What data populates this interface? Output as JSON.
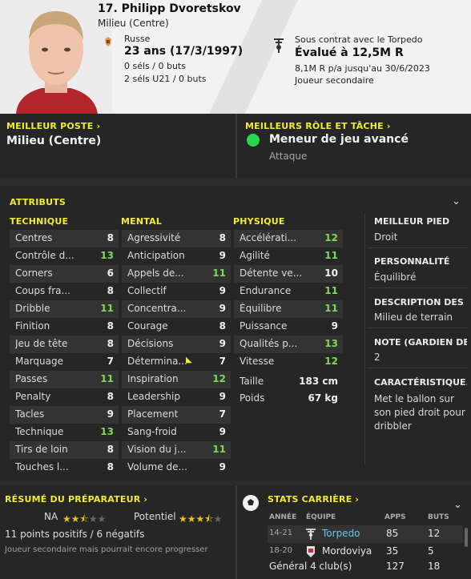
{
  "header": {
    "name": "17. Philipp Dvoretskov",
    "position": "Milieu (Centre)",
    "nationality": "Russe",
    "age": "23 ans (17/3/1997)",
    "selections": "0 séls / 0 buts",
    "u21": "2 séls U21 / 0 buts",
    "contract": "Sous contrat avec le Torpedo",
    "value": "Évalué à 12,5M R",
    "wage": "8,1M R p/a jusqu'au 30/6/2023",
    "squad_role": "Joueur secondaire"
  },
  "best_position": {
    "title": "MEILLEUR POSTE",
    "value": "Milieu (Centre)"
  },
  "best_role": {
    "title": "MEILLEURS RÔLE ET TÂCHE",
    "role": "Meneur de jeu avancé",
    "duty": "Attaque"
  },
  "attributes": {
    "title": "ATTRIBUTS",
    "technical": {
      "title": "TECHNIQUE",
      "items": [
        {
          "n": "Centres",
          "v": "8",
          "c": "w"
        },
        {
          "n": "Contrôle d...",
          "v": "13",
          "c": "g"
        },
        {
          "n": "Corners",
          "v": "6",
          "c": "w"
        },
        {
          "n": "Coups fra...",
          "v": "8",
          "c": "w"
        },
        {
          "n": "Dribble",
          "v": "11",
          "c": "g"
        },
        {
          "n": "Finition",
          "v": "8",
          "c": "w"
        },
        {
          "n": "Jeu de tête",
          "v": "8",
          "c": "w"
        },
        {
          "n": "Marquage",
          "v": "7",
          "c": "w"
        },
        {
          "n": "Passes",
          "v": "11",
          "c": "g"
        },
        {
          "n": "Penalty",
          "v": "8",
          "c": "w"
        },
        {
          "n": "Tacles",
          "v": "9",
          "c": "w"
        },
        {
          "n": "Technique",
          "v": "13",
          "c": "g"
        },
        {
          "n": "Tirs de loin",
          "v": "8",
          "c": "w"
        },
        {
          "n": "Touches l...",
          "v": "8",
          "c": "w"
        }
      ]
    },
    "mental": {
      "title": "MENTAL",
      "items": [
        {
          "n": "Agressivité",
          "v": "8",
          "c": "w"
        },
        {
          "n": "Anticipation",
          "v": "9",
          "c": "w"
        },
        {
          "n": "Appels de...",
          "v": "11",
          "c": "g"
        },
        {
          "n": "Collectif",
          "v": "9",
          "c": "w"
        },
        {
          "n": "Concentra...",
          "v": "9",
          "c": "w"
        },
        {
          "n": "Courage",
          "v": "8",
          "c": "w"
        },
        {
          "n": "Décisions",
          "v": "9",
          "c": "w"
        },
        {
          "n": "Détermina...",
          "v": "7",
          "c": "w"
        },
        {
          "n": "Inspiration",
          "v": "12",
          "c": "g"
        },
        {
          "n": "Leadership",
          "v": "9",
          "c": "w"
        },
        {
          "n": "Placement",
          "v": "7",
          "c": "w"
        },
        {
          "n": "Sang-froid",
          "v": "9",
          "c": "w"
        },
        {
          "n": "Vision du j...",
          "v": "11",
          "c": "g"
        },
        {
          "n": "Volume de...",
          "v": "9",
          "c": "w"
        }
      ]
    },
    "physical": {
      "title": "PHYSIQUE",
      "items": [
        {
          "n": "Accélérati...",
          "v": "12",
          "c": "g"
        },
        {
          "n": "Agilité",
          "v": "11",
          "c": "g"
        },
        {
          "n": "Détente ve...",
          "v": "10",
          "c": "w"
        },
        {
          "n": "Endurance",
          "v": "11",
          "c": "g"
        },
        {
          "n": "Équilibre",
          "v": "11",
          "c": "g"
        },
        {
          "n": "Puissance",
          "v": "9",
          "c": "w"
        },
        {
          "n": "Qualités p...",
          "v": "13",
          "c": "g"
        },
        {
          "n": "Vitesse",
          "v": "12",
          "c": "g"
        }
      ]
    },
    "height_label": "Taille",
    "height": "183 cm",
    "weight_label": "Poids",
    "weight": "67 kg"
  },
  "side": {
    "foot_title": "MEILLEUR PIED",
    "foot": "Droit",
    "pers_title": "PERSONNALITÉ",
    "pers": "Équilibré",
    "desc_title": "DESCRIPTION DES...",
    "desc": "Milieu de terrain",
    "note_title": "NOTE (GARDIEN DE...",
    "note": "2",
    "char_title": "CARACTÉRISTIQUE...",
    "char": "Met le ballon sur son pied droit pour dribbler"
  },
  "coach": {
    "title": "RÉSUMÉ DU PRÉPARATEUR",
    "na_label": "NA",
    "na_stars": 2.5,
    "pot_label": "Potentiel",
    "pot_stars": 3.5,
    "points": "11 points positifs / 6 négatifs",
    "summary": "Joueur secondaire mais pourrait encore progresser"
  },
  "career": {
    "title": "STATS CARRIÈRE",
    "col_season": "ANNÉE",
    "col_team": "ÉQUIPE",
    "col_apps": "APPS",
    "col_goals": "BUTS",
    "rows": [
      {
        "season": "14-21",
        "team": "Torpedo",
        "apps": "85",
        "goals": "12"
      },
      {
        "season": "18-20",
        "team": "Mordoviya",
        "apps": "35",
        "goals": "5"
      }
    ],
    "total_label": "Général 4 club(s)",
    "total_apps": "127",
    "total_goals": "18"
  },
  "colors": {
    "accent": "#f1ed2c",
    "positive": "#7ed957",
    "link": "#6bc3e8"
  }
}
